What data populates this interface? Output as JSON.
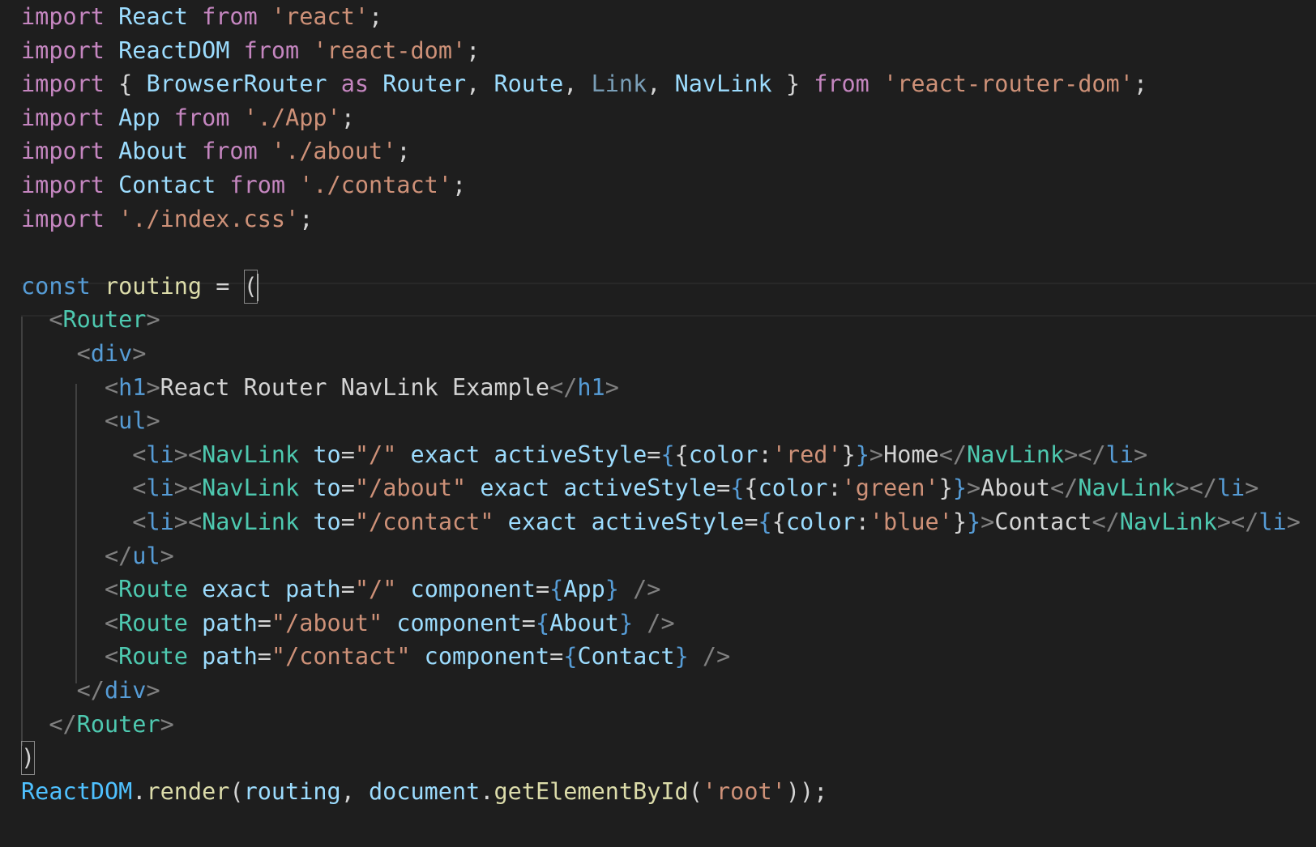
{
  "editor": {
    "language": "javascript-jsx",
    "theme": "dark",
    "colors": {
      "background": "#1e1e1e",
      "keyword": "#c586c0",
      "string": "#ce9178",
      "variable": "#9cdcfe",
      "component_tag": "#4ec9b0",
      "html_tag": "#569cd6",
      "function": "#dcdcaa"
    },
    "lines": [
      [
        {
          "t": "import",
          "c": "kw"
        },
        {
          "t": " "
        },
        {
          "t": "React",
          "c": "var"
        },
        {
          "t": " "
        },
        {
          "t": "from",
          "c": "kw"
        },
        {
          "t": " "
        },
        {
          "t": "'react'",
          "c": "st"
        },
        {
          "t": ";",
          "c": "punc"
        }
      ],
      [
        {
          "t": "import",
          "c": "kw"
        },
        {
          "t": " "
        },
        {
          "t": "ReactDOM",
          "c": "var"
        },
        {
          "t": " "
        },
        {
          "t": "from",
          "c": "kw"
        },
        {
          "t": " "
        },
        {
          "t": "'react-dom'",
          "c": "st"
        },
        {
          "t": ";",
          "c": "punc"
        }
      ],
      [
        {
          "t": "import",
          "c": "kw"
        },
        {
          "t": " "
        },
        {
          "t": "{",
          "c": "punc"
        },
        {
          "t": " "
        },
        {
          "t": "BrowserRouter",
          "c": "var"
        },
        {
          "t": " "
        },
        {
          "t": "as",
          "c": "kw"
        },
        {
          "t": " "
        },
        {
          "t": "Router",
          "c": "var"
        },
        {
          "t": ", ",
          "c": "punc"
        },
        {
          "t": "Route",
          "c": "var"
        },
        {
          "t": ", ",
          "c": "punc"
        },
        {
          "t": "Link",
          "c": "link"
        },
        {
          "t": ", ",
          "c": "punc"
        },
        {
          "t": "NavLink",
          "c": "var"
        },
        {
          "t": " "
        },
        {
          "t": "}",
          "c": "punc"
        },
        {
          "t": " "
        },
        {
          "t": "from",
          "c": "kw"
        },
        {
          "t": " "
        },
        {
          "t": "'react-router-dom'",
          "c": "st"
        },
        {
          "t": ";",
          "c": "punc"
        }
      ],
      [
        {
          "t": "import",
          "c": "kw"
        },
        {
          "t": " "
        },
        {
          "t": "App",
          "c": "var"
        },
        {
          "t": " "
        },
        {
          "t": "from",
          "c": "kw"
        },
        {
          "t": " "
        },
        {
          "t": "'./App'",
          "c": "st"
        },
        {
          "t": ";",
          "c": "punc"
        }
      ],
      [
        {
          "t": "import",
          "c": "kw"
        },
        {
          "t": " "
        },
        {
          "t": "About",
          "c": "var"
        },
        {
          "t": " "
        },
        {
          "t": "from",
          "c": "kw"
        },
        {
          "t": " "
        },
        {
          "t": "'./about'",
          "c": "st"
        },
        {
          "t": ";",
          "c": "punc"
        }
      ],
      [
        {
          "t": "import",
          "c": "kw"
        },
        {
          "t": " "
        },
        {
          "t": "Contact",
          "c": "var"
        },
        {
          "t": " "
        },
        {
          "t": "from",
          "c": "kw"
        },
        {
          "t": " "
        },
        {
          "t": "'./contact'",
          "c": "st"
        },
        {
          "t": ";",
          "c": "punc"
        }
      ],
      [
        {
          "t": "import",
          "c": "kw"
        },
        {
          "t": " "
        },
        {
          "t": "'./index.css'",
          "c": "st"
        },
        {
          "t": ";",
          "c": "punc"
        }
      ],
      [],
      [
        {
          "t": "const",
          "c": "const"
        },
        {
          "t": " "
        },
        {
          "t": "routing",
          "c": "fn"
        },
        {
          "t": " "
        },
        {
          "t": "=",
          "c": "punc"
        },
        {
          "t": " "
        },
        {
          "t": "(",
          "c": "punc",
          "box": true,
          "caret": true
        }
      ],
      [
        {
          "t": "  "
        },
        {
          "t": "<",
          "c": "angle"
        },
        {
          "t": "Router",
          "c": "tag"
        },
        {
          "t": ">",
          "c": "angle"
        }
      ],
      [
        {
          "t": "    "
        },
        {
          "t": "<",
          "c": "angle"
        },
        {
          "t": "div",
          "c": "html"
        },
        {
          "t": ">",
          "c": "angle"
        }
      ],
      [
        {
          "t": "      "
        },
        {
          "t": "<",
          "c": "angle"
        },
        {
          "t": "h1",
          "c": "html"
        },
        {
          "t": ">",
          "c": "angle"
        },
        {
          "t": "React Router NavLink Example",
          "c": "text"
        },
        {
          "t": "</",
          "c": "angle"
        },
        {
          "t": "h1",
          "c": "html"
        },
        {
          "t": ">",
          "c": "angle"
        }
      ],
      [
        {
          "t": "      "
        },
        {
          "t": "<",
          "c": "angle"
        },
        {
          "t": "ul",
          "c": "html"
        },
        {
          "t": ">",
          "c": "angle"
        }
      ],
      [
        {
          "t": "        "
        },
        {
          "t": "<",
          "c": "angle"
        },
        {
          "t": "li",
          "c": "html"
        },
        {
          "t": "><",
          "c": "angle"
        },
        {
          "t": "NavLink",
          "c": "tag"
        },
        {
          "t": " "
        },
        {
          "t": "to",
          "c": "var"
        },
        {
          "t": "=",
          "c": "punc"
        },
        {
          "t": "\"/\"",
          "c": "st"
        },
        {
          "t": " "
        },
        {
          "t": "exact",
          "c": "var"
        },
        {
          "t": " "
        },
        {
          "t": "activeStyle",
          "c": "var"
        },
        {
          "t": "=",
          "c": "punc"
        },
        {
          "t": "{",
          "c": "brace"
        },
        {
          "t": "{",
          "c": "punc"
        },
        {
          "t": "color",
          "c": "var"
        },
        {
          "t": ":",
          "c": "punc"
        },
        {
          "t": "'red'",
          "c": "st"
        },
        {
          "t": "}",
          "c": "punc"
        },
        {
          "t": "}",
          "c": "brace"
        },
        {
          "t": ">",
          "c": "angle"
        },
        {
          "t": "Home",
          "c": "text"
        },
        {
          "t": "</",
          "c": "angle"
        },
        {
          "t": "NavLink",
          "c": "tag"
        },
        {
          "t": "></",
          "c": "angle"
        },
        {
          "t": "li",
          "c": "html"
        },
        {
          "t": ">",
          "c": "angle"
        }
      ],
      [
        {
          "t": "        "
        },
        {
          "t": "<",
          "c": "angle"
        },
        {
          "t": "li",
          "c": "html"
        },
        {
          "t": "><",
          "c": "angle"
        },
        {
          "t": "NavLink",
          "c": "tag"
        },
        {
          "t": " "
        },
        {
          "t": "to",
          "c": "var"
        },
        {
          "t": "=",
          "c": "punc"
        },
        {
          "t": "\"/about\"",
          "c": "st"
        },
        {
          "t": " "
        },
        {
          "t": "exact",
          "c": "var"
        },
        {
          "t": " "
        },
        {
          "t": "activeStyle",
          "c": "var"
        },
        {
          "t": "=",
          "c": "punc"
        },
        {
          "t": "{",
          "c": "brace"
        },
        {
          "t": "{",
          "c": "punc"
        },
        {
          "t": "color",
          "c": "var"
        },
        {
          "t": ":",
          "c": "punc"
        },
        {
          "t": "'green'",
          "c": "st"
        },
        {
          "t": "}",
          "c": "punc"
        },
        {
          "t": "}",
          "c": "brace"
        },
        {
          "t": ">",
          "c": "angle"
        },
        {
          "t": "About",
          "c": "text"
        },
        {
          "t": "</",
          "c": "angle"
        },
        {
          "t": "NavLink",
          "c": "tag"
        },
        {
          "t": "></",
          "c": "angle"
        },
        {
          "t": "li",
          "c": "html"
        },
        {
          "t": ">",
          "c": "angle"
        }
      ],
      [
        {
          "t": "        "
        },
        {
          "t": "<",
          "c": "angle"
        },
        {
          "t": "li",
          "c": "html"
        },
        {
          "t": "><",
          "c": "angle"
        },
        {
          "t": "NavLink",
          "c": "tag"
        },
        {
          "t": " "
        },
        {
          "t": "to",
          "c": "var"
        },
        {
          "t": "=",
          "c": "punc"
        },
        {
          "t": "\"/contact\"",
          "c": "st"
        },
        {
          "t": " "
        },
        {
          "t": "exact",
          "c": "var"
        },
        {
          "t": " "
        },
        {
          "t": "activeStyle",
          "c": "var"
        },
        {
          "t": "=",
          "c": "punc"
        },
        {
          "t": "{",
          "c": "brace"
        },
        {
          "t": "{",
          "c": "punc"
        },
        {
          "t": "color",
          "c": "var"
        },
        {
          "t": ":",
          "c": "punc"
        },
        {
          "t": "'blue'",
          "c": "st"
        },
        {
          "t": "}",
          "c": "punc"
        },
        {
          "t": "}",
          "c": "brace"
        },
        {
          "t": ">",
          "c": "angle"
        },
        {
          "t": "Contact",
          "c": "text"
        },
        {
          "t": "</",
          "c": "angle"
        },
        {
          "t": "NavLink",
          "c": "tag"
        },
        {
          "t": "></",
          "c": "angle"
        },
        {
          "t": "li",
          "c": "html"
        },
        {
          "t": ">",
          "c": "angle"
        }
      ],
      [
        {
          "t": "      "
        },
        {
          "t": "</",
          "c": "angle"
        },
        {
          "t": "ul",
          "c": "html"
        },
        {
          "t": ">",
          "c": "angle"
        }
      ],
      [
        {
          "t": "      "
        },
        {
          "t": "<",
          "c": "angle"
        },
        {
          "t": "Route",
          "c": "tag"
        },
        {
          "t": " "
        },
        {
          "t": "exact",
          "c": "var"
        },
        {
          "t": " "
        },
        {
          "t": "path",
          "c": "var"
        },
        {
          "t": "=",
          "c": "punc"
        },
        {
          "t": "\"/\"",
          "c": "st"
        },
        {
          "t": " "
        },
        {
          "t": "component",
          "c": "var"
        },
        {
          "t": "=",
          "c": "punc"
        },
        {
          "t": "{",
          "c": "brace"
        },
        {
          "t": "App",
          "c": "var"
        },
        {
          "t": "}",
          "c": "brace"
        },
        {
          "t": " "
        },
        {
          "t": "/>",
          "c": "angle"
        }
      ],
      [
        {
          "t": "      "
        },
        {
          "t": "<",
          "c": "angle"
        },
        {
          "t": "Route",
          "c": "tag"
        },
        {
          "t": " "
        },
        {
          "t": "path",
          "c": "var"
        },
        {
          "t": "=",
          "c": "punc"
        },
        {
          "t": "\"/about\"",
          "c": "st"
        },
        {
          "t": " "
        },
        {
          "t": "component",
          "c": "var"
        },
        {
          "t": "=",
          "c": "punc"
        },
        {
          "t": "{",
          "c": "brace"
        },
        {
          "t": "About",
          "c": "var"
        },
        {
          "t": "}",
          "c": "brace"
        },
        {
          "t": " "
        },
        {
          "t": "/>",
          "c": "angle"
        }
      ],
      [
        {
          "t": "      "
        },
        {
          "t": "<",
          "c": "angle"
        },
        {
          "t": "Route",
          "c": "tag"
        },
        {
          "t": " "
        },
        {
          "t": "path",
          "c": "var"
        },
        {
          "t": "=",
          "c": "punc"
        },
        {
          "t": "\"/contact\"",
          "c": "st"
        },
        {
          "t": " "
        },
        {
          "t": "component",
          "c": "var"
        },
        {
          "t": "=",
          "c": "punc"
        },
        {
          "t": "{",
          "c": "brace"
        },
        {
          "t": "Contact",
          "c": "var"
        },
        {
          "t": "}",
          "c": "brace"
        },
        {
          "t": " "
        },
        {
          "t": "/>",
          "c": "angle"
        }
      ],
      [
        {
          "t": "    "
        },
        {
          "t": "</",
          "c": "angle"
        },
        {
          "t": "div",
          "c": "html"
        },
        {
          "t": ">",
          "c": "angle"
        }
      ],
      [
        {
          "t": "  "
        },
        {
          "t": "</",
          "c": "angle"
        },
        {
          "t": "Router",
          "c": "tag"
        },
        {
          "t": ">",
          "c": "angle"
        }
      ],
      [
        {
          "t": ")",
          "c": "punc",
          "box": true
        }
      ],
      [
        {
          "t": "ReactDOM",
          "c": "obj"
        },
        {
          "t": ".",
          "c": "punc"
        },
        {
          "t": "render",
          "c": "fn"
        },
        {
          "t": "(",
          "c": "punc"
        },
        {
          "t": "routing",
          "c": "var"
        },
        {
          "t": ", ",
          "c": "punc"
        },
        {
          "t": "document",
          "c": "var"
        },
        {
          "t": ".",
          "c": "punc"
        },
        {
          "t": "getElementById",
          "c": "fn"
        },
        {
          "t": "(",
          "c": "punc"
        },
        {
          "t": "'root'",
          "c": "st"
        },
        {
          "t": "));",
          "c": "punc"
        }
      ]
    ]
  }
}
